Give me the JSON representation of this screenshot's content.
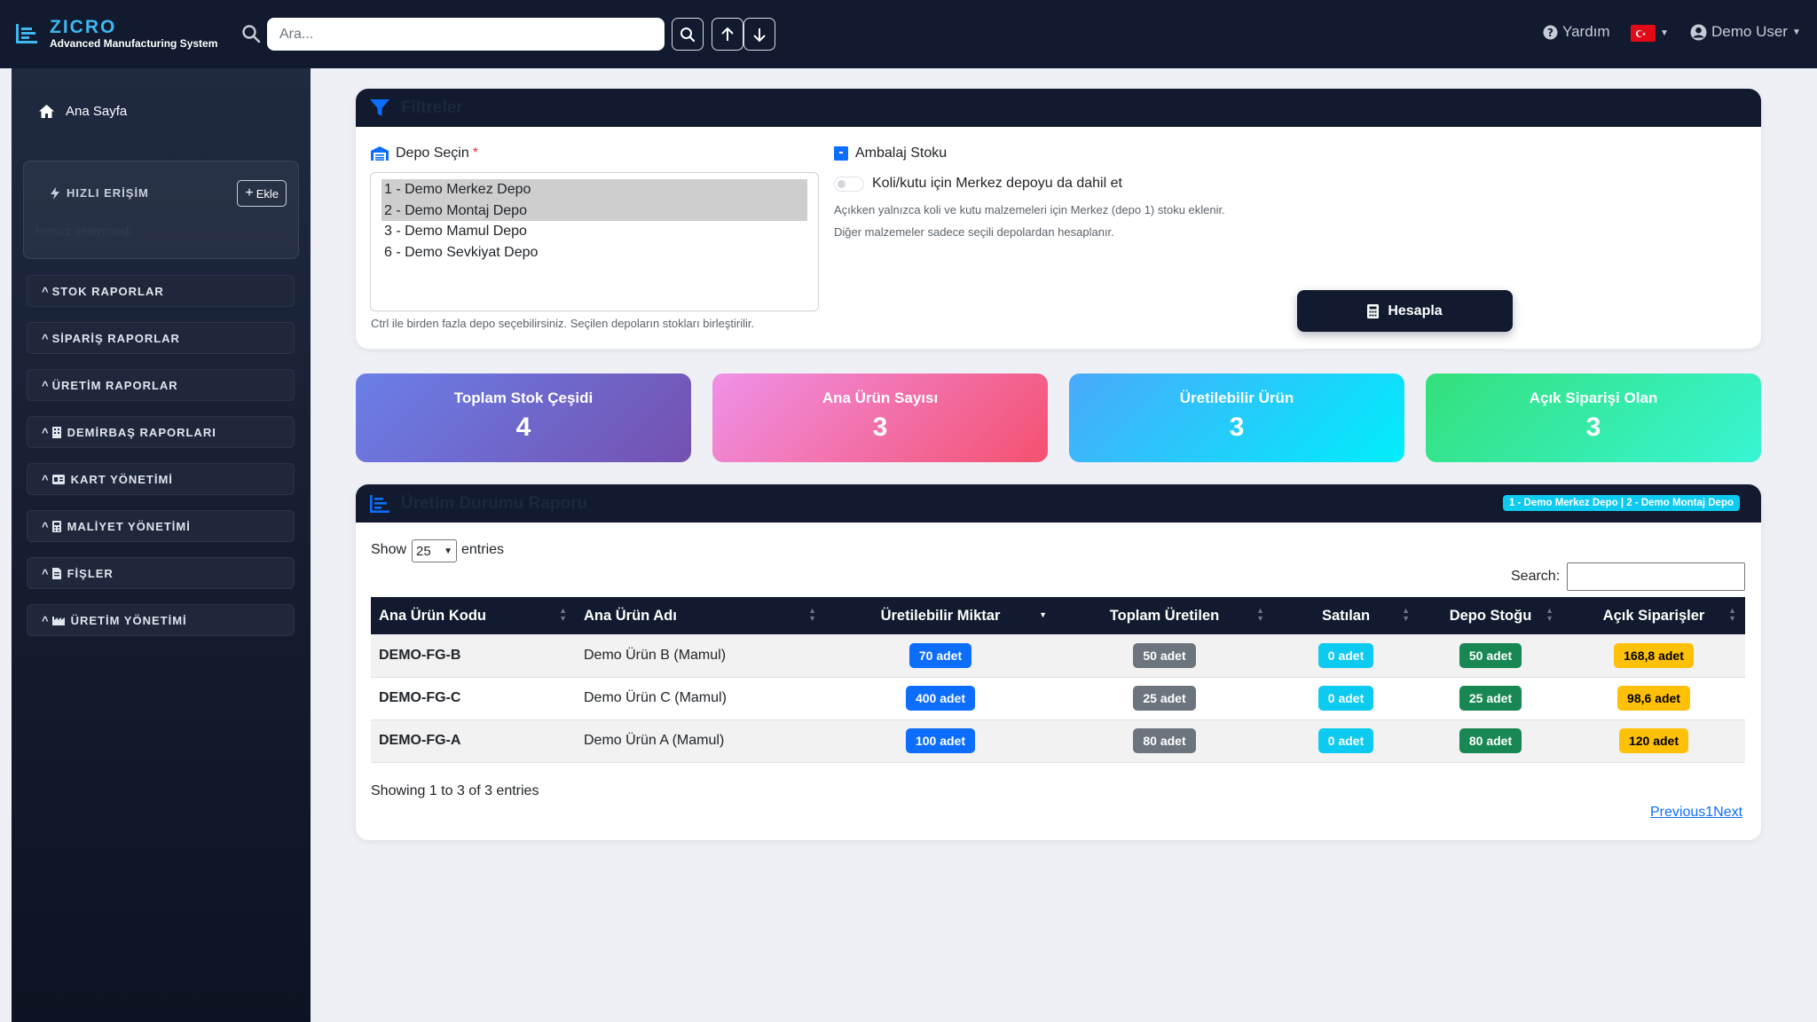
{
  "app": {
    "name": "ZICRO",
    "subtitle": "Advanced Manufacturing System"
  },
  "topbar": {
    "search_placeholder": "Ara...",
    "help": "Yardım",
    "user": "Demo User",
    "language_flag": "tr-flag-icon"
  },
  "sidebar": {
    "home": "Ana Sayfa",
    "quick_access": {
      "title": "HIZLI ERİŞİM",
      "add_label": "Ekle",
      "empty_text": "Henüz eklenmedi"
    },
    "menu": [
      {
        "label": "STOK RAPORLAR",
        "icon": ""
      },
      {
        "label": "SİPARİŞ RAPORLAR",
        "icon": ""
      },
      {
        "label": "ÜRETİM RAPORLAR",
        "icon": ""
      },
      {
        "label": "DEMİRBAŞ RAPORLARI",
        "icon": "building-icon"
      },
      {
        "label": "KART YÖNETİMİ",
        "icon": "id-card-icon"
      },
      {
        "label": "MALİYET YÖNETİMİ",
        "icon": "calculator-icon"
      },
      {
        "label": "FİŞLER",
        "icon": "receipt-icon"
      },
      {
        "label": "ÜRETİM YÖNETİMİ",
        "icon": "industry-icon"
      }
    ]
  },
  "filters": {
    "title": "Filtreler",
    "depot_label": "Depo Seçin",
    "required_mark": "*",
    "depots": [
      {
        "label": "1 - Demo Merkez Depo",
        "selected": true
      },
      {
        "label": "2 - Demo Montaj Depo",
        "selected": true
      },
      {
        "label": "3 - Demo Mamul Depo",
        "selected": false
      },
      {
        "label": "6 - Demo Sevkiyat Depo",
        "selected": false
      }
    ],
    "depot_hint": "Ctrl ile birden fazla depo seçebilirsiniz. Seçilen depoların stokları birleştirilir.",
    "packaging_label": "Ambalaj Stoku",
    "toggle_label": "Koli/kutu için Merkez depoyu da dahil et",
    "toggle_on": false,
    "packaging_hint1": "Açıkken yalnızca koli ve kutu malzemeleri için Merkez (depo 1) stoku eklenir.",
    "packaging_hint2": "Diğer malzemeler sadece seçili depolardan hesaplanır.",
    "calculate_button": "Hesapla"
  },
  "stats": [
    {
      "label": "Toplam Stok Çeşidi",
      "value": "4"
    },
    {
      "label": "Ana Ürün Sayısı",
      "value": "3"
    },
    {
      "label": "Üretilebilir Ürün",
      "value": "3"
    },
    {
      "label": "Açık Siparişi Olan",
      "value": "3"
    }
  ],
  "report": {
    "title": "Üretim Durumu Raporu",
    "depot_badge": "1 - Demo Merkez Depo | 2 - Demo Montaj Depo",
    "show_label": "Show",
    "page_length": "25",
    "entries_label": "entries",
    "search_label": "Search:",
    "columns": [
      "Ana Ürün Kodu",
      "Ana Ürün Adı",
      "Üretilebilir Miktar",
      "Toplam Üretilen",
      "Satılan",
      "Depo Stoğu",
      "Açık Siparişler"
    ],
    "rows": [
      {
        "code": "DEMO-FG-B",
        "name": "Demo Ürün B (Mamul)",
        "producible": "70 adet",
        "total_produced": "50 adet",
        "sold": "0 adet",
        "stock": "50 adet",
        "open_orders": "168,8 adet"
      },
      {
        "code": "DEMO-FG-C",
        "name": "Demo Ürün C (Mamul)",
        "producible": "400 adet",
        "total_produced": "25 adet",
        "sold": "0 adet",
        "stock": "25 adet",
        "open_orders": "98,6 adet"
      },
      {
        "code": "DEMO-FG-A",
        "name": "Demo Ürün A (Mamul)",
        "producible": "100 adet",
        "total_produced": "80 adet",
        "sold": "0 adet",
        "stock": "80 adet",
        "open_orders": "120 adet"
      }
    ],
    "info": "Showing 1 to 3 of 3 entries",
    "pagination": {
      "previous": "Previous",
      "page": "1",
      "next": "Next"
    }
  },
  "colors": {
    "navbar": "#111a2e",
    "brand_accent": "#3fb7f0",
    "primary": "#0d6efd",
    "secondary": "#6c757d",
    "info": "#0dcaf0",
    "success": "#198754",
    "warning": "#ffc107"
  }
}
